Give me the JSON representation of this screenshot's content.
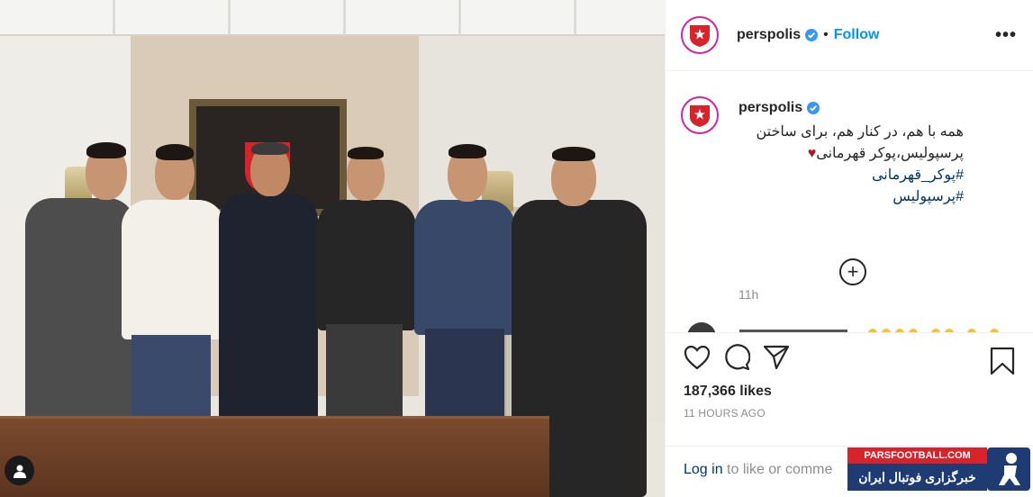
{
  "header": {
    "username": "perspolis",
    "follow_label": "Follow",
    "dot": "•",
    "more": "•••"
  },
  "caption": {
    "username": "perspolis",
    "text_line1": "همه با هم، در کنار هم، برای ساختن",
    "text_line2": "پرسپولیس،پوکر قهرمانی",
    "heart": "♥",
    "hashtag1": "#پوکر_قهرمانی",
    "hashtag2": "#پرسپولیس",
    "time": "11h"
  },
  "actions": {
    "likes": "187,366 likes",
    "posted": "11 HOURS AGO"
  },
  "login": {
    "login_label": "Log in",
    "rest": " to like or comme"
  },
  "watermark": {
    "site": "PARSFOOTBALL.COM",
    "title": "خبرگزاری فوتبال ایران"
  },
  "colors": {
    "follow_blue": "#0095f6",
    "verified_blue": "#3897f0",
    "story_ring": "#d6249f",
    "club_red": "#d8232a"
  },
  "icons": [
    "verified-badge-icon",
    "more-options-icon",
    "add-comment-icon",
    "heart-icon",
    "comment-icon",
    "share-icon",
    "bookmark-icon",
    "user-tag-icon"
  ]
}
